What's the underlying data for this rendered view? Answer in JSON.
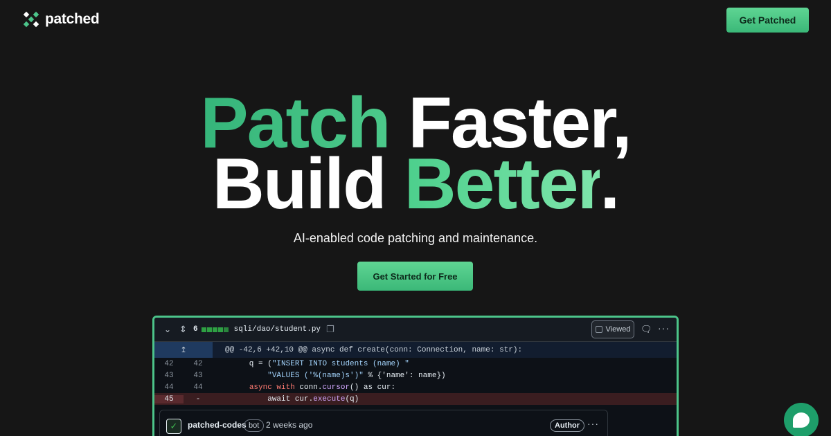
{
  "brand": {
    "name": "patched"
  },
  "nav": {
    "cta_label": "Get Patched"
  },
  "hero": {
    "line1_a": "Patch",
    "line1_b": " Faster,",
    "line2_a": "Build ",
    "line2_b": "Better",
    "line2_c": ".",
    "subtitle": "AI-enabled code patching and maintenance.",
    "cta_label": "Get Started for Free"
  },
  "diff": {
    "change_count": "6",
    "file_path": "sqli/dao/student.py",
    "viewed_label": "Viewed",
    "hunk_header": "@@ -42,6 +42,10 @@ async def create(conn: Connection, name: str):",
    "lines": [
      {
        "old": "42",
        "new": "42",
        "marker": "",
        "pre": "        q = (",
        "str": "\"INSERT INTO students (name) \"",
        "post": ""
      },
      {
        "old": "43",
        "new": "43",
        "marker": "",
        "pre": "            ",
        "str": "\"VALUES ('%(name)s')\"",
        "post": " % {'name': name})"
      },
      {
        "old": "44",
        "new": "44",
        "marker": "",
        "pre": "        ",
        "str": "",
        "post": ""
      },
      {
        "old": "45",
        "new": "",
        "marker": "-",
        "pre": "            await cur.",
        "str": "",
        "post": ""
      }
    ],
    "line44_kw": "async with",
    "line44_rest": " conn.",
    "line44_fn": "cursor",
    "line44_tail": "() as cur:",
    "line45_fn": "execute",
    "line45_tail": "(q)"
  },
  "comment": {
    "author": "patched-codes",
    "badge": "bot",
    "time": "2 weeks ago",
    "role": "Author"
  },
  "colors": {
    "accent": "#4cc48a",
    "background": "#161616"
  }
}
